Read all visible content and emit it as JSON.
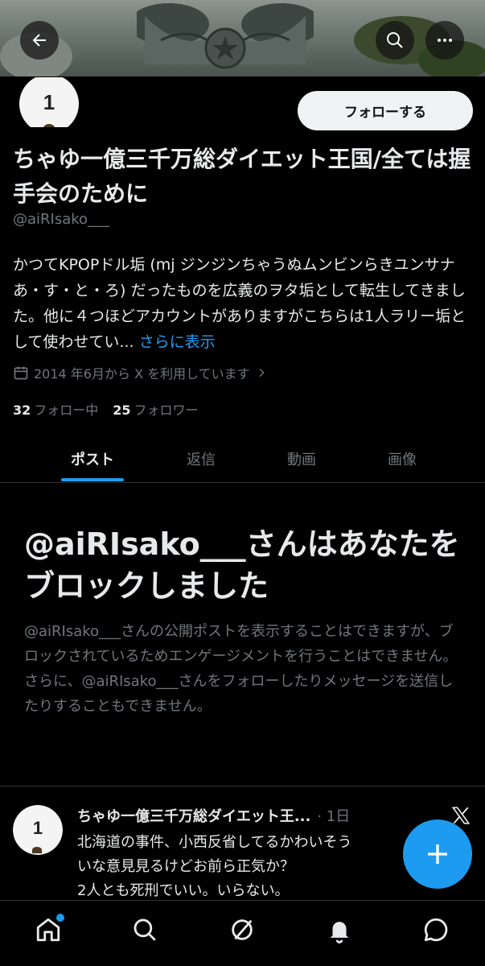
{
  "profile": {
    "display_name": "ちゃゆ一億三千万総ダイエット王国/全ては握手会のために",
    "handle": "@aiRIsako___",
    "avatar_text": "1",
    "follow_label": "フォローする",
    "bio": "かつてKPOPドル垢 (mj ジンジンちゃうぬムンビンらきユンサナあ・す・と・ろ) だったものを広義のヲタ垢として転生してきました。他に４つほどアカウントがありますがこちらは1人ラリー垢として使わせてい...",
    "bio_more": "さらに表示",
    "joined": "2014 年6月から X を利用しています",
    "following_count": "32",
    "following_label": "フォロー中",
    "followers_count": "25",
    "followers_label": "フォロワー"
  },
  "tabs": [
    {
      "label": "ポスト"
    },
    {
      "label": "返信"
    },
    {
      "label": "動画"
    },
    {
      "label": "画像"
    }
  ],
  "blocked": {
    "title": "@aiRIsako___さんはあなたをブロックしました",
    "description": "@aiRIsako___さんの公開ポストを表示することはできますが、ブロックされているためエンゲージメントを行うことはできません。さらに、@aiRIsako___さんをフォローしたりメッセージを送信したりすることもできません。"
  },
  "post": {
    "avatar_text": "1",
    "name": "ちゃゆ一億三千万総ダイエット王...",
    "time": "· 1日",
    "lines": [
      "北海道の事件、小西反省してるかわいそう",
      "いな意見見るけどお前ら正気か？",
      "2人とも死刑でいい。いらない。"
    ]
  },
  "icons": {
    "back": "back-arrow-icon",
    "search": "search-icon",
    "more": "more-icon",
    "calendar": "calendar-icon",
    "chevron": "chevron-right-icon",
    "compose": "plus-icon",
    "x_logo": "x-logo-icon"
  },
  "nav": [
    {
      "icon": "home-icon",
      "has_badge": true
    },
    {
      "icon": "search-icon"
    },
    {
      "icon": "grok-icon"
    },
    {
      "icon": "bell-icon"
    },
    {
      "icon": "messages-icon"
    }
  ],
  "colors": {
    "accent": "#1d9bf0",
    "background": "#000000",
    "muted_text": "#71767b"
  }
}
